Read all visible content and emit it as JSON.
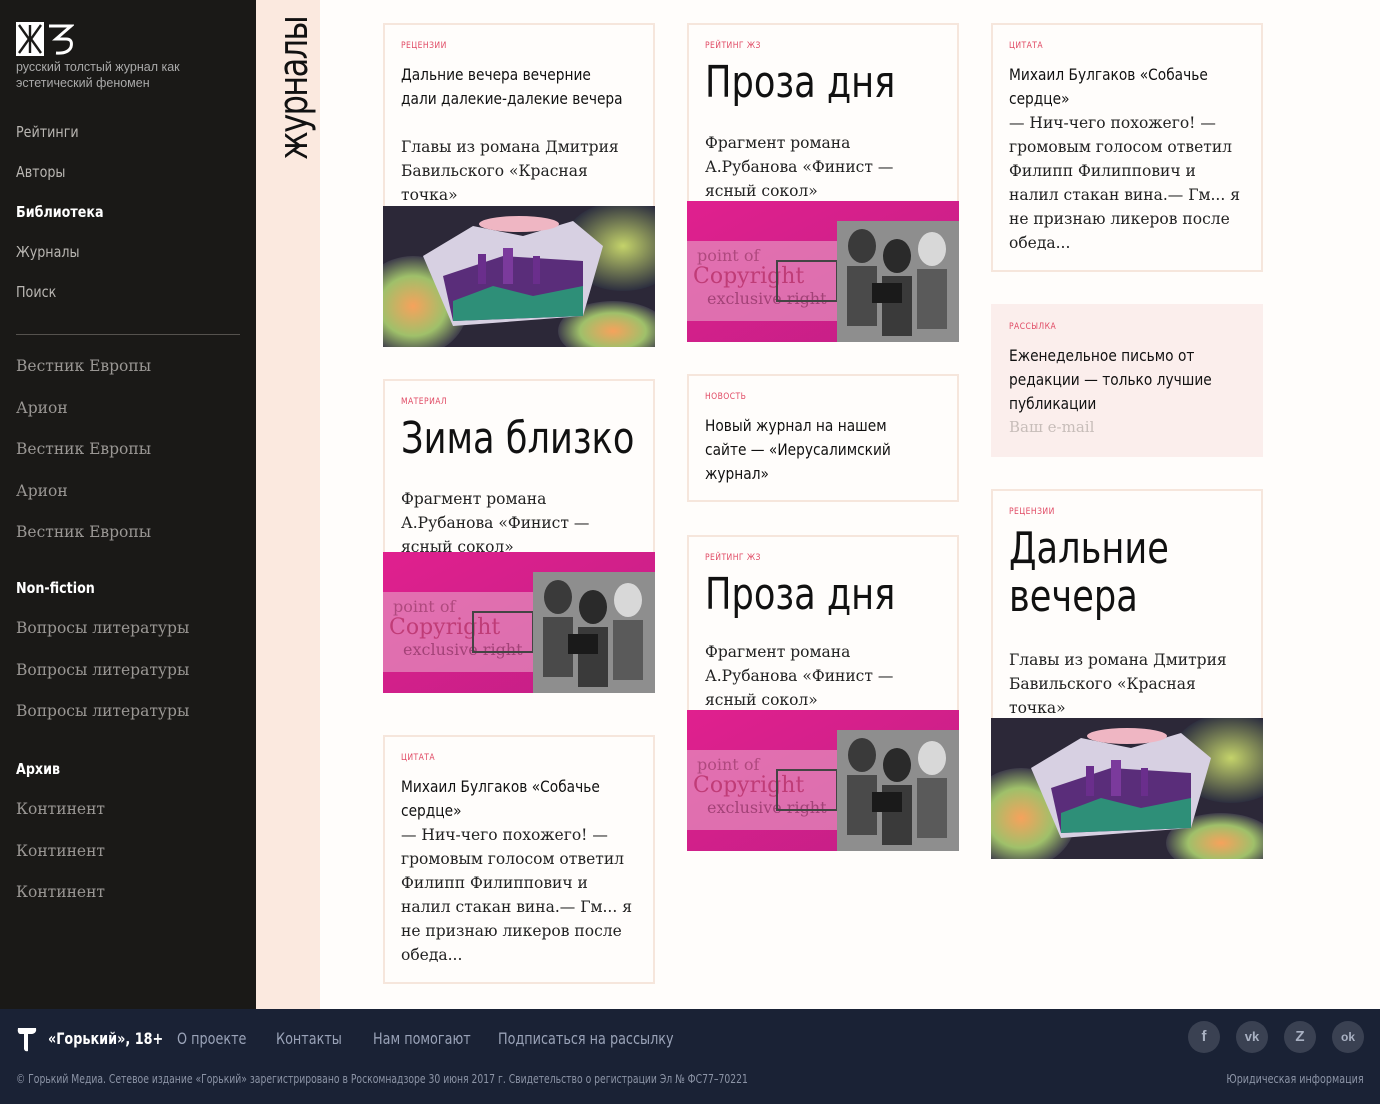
{
  "brand": {
    "logo_text": "ЖЗ",
    "tagline": "русский толстый журнал как эстетический феномен"
  },
  "nav": {
    "items": [
      {
        "label": "Рейтинги",
        "active": false
      },
      {
        "label": "Авторы",
        "active": false
      },
      {
        "label": "Библиотека",
        "active": true
      },
      {
        "label": "Журналы",
        "active": false
      },
      {
        "label": "Поиск",
        "active": false
      }
    ]
  },
  "journals": {
    "group1": [
      "Вестник Европы",
      "Арион",
      "Вестник Европы",
      "Арион",
      "Вестник Европы"
    ],
    "nonfiction_heading": "Non-fiction",
    "group2": [
      "Вопросы литературы",
      "Вопросы литературы",
      "Вопросы литературы"
    ],
    "archive_heading": "Архив",
    "group3": [
      "Континент",
      "Континент",
      "Континент"
    ]
  },
  "section_title": "журналы",
  "cards": {
    "c1": {
      "tag": "рецензии",
      "headline": "Дальние вечера вечерние дали далекие-далекие вечера",
      "desc": "Главы из романа Дмитрия Бавильского «Красная точка»"
    },
    "c2": {
      "tag": "материал",
      "title": "Зима близко",
      "desc": "Фрагмент романа А.Рубанова «Финист — ясный сокол»"
    },
    "c3": {
      "tag": "цитата",
      "headline": "Михаил Булгаков «Собачье сердце»",
      "desc": "— Нич-чего похожего! — громовым голосом ответил Филипп Филиппович и налил стакан вина.— Гм... я не признаю ликеров после обеда..."
    },
    "c4": {
      "tag": "рейтинг жз",
      "title": "Проза дня",
      "desc": "Фрагмент романа А.Рубанова «Финист — ясный сокол»"
    },
    "c5": {
      "tag": "новость",
      "headline": "Новый журнал на нашем сайте — «Иерусалимский журнал»"
    },
    "c6": {
      "tag": "рейтинг жз",
      "title": "Проза дня",
      "desc": "Фрагмент романа А.Рубанова «Финист — ясный сокол»"
    },
    "c7": {
      "tag": "цитата",
      "headline": "Михаил Булгаков «Собачье сердце»",
      "desc": "— Нич-чего похожего! — громовым голосом ответил Филипп Филиппович и налил стакан вина.— Гм... я не признаю ликеров после обеда..."
    },
    "c8": {
      "tag": "рассылка",
      "headline": "Еженедельное письмо от редакции — только лучшие публикации",
      "email_placeholder": "Ваш e-mail"
    },
    "c9": {
      "tag": "рецензии",
      "title": "Дальние вечера",
      "desc": "Главы из романа Дмитрия Бавильского «Красная точка»"
    }
  },
  "footer": {
    "brand": "«Горький», 18+",
    "links": [
      "О проекте",
      "Контакты",
      "Нам помогают",
      "Подписаться на рассылку"
    ],
    "social": [
      {
        "icon": "facebook-icon",
        "glyph": "f"
      },
      {
        "icon": "vk-icon",
        "glyph": "vk"
      },
      {
        "icon": "livejournal-icon",
        "glyph": "Z"
      },
      {
        "icon": "odnoklassniki-icon",
        "glyph": "ok"
      }
    ],
    "copyright": "© Горький Медиа. Сетевое издание «Горький» зарегистрировано в Роскомнадзоре 30 июня 2017 г. Свидетельство о регистрации Эл № ФС77–70221",
    "legal": "Юридическая информация"
  },
  "colors": {
    "sidebar_bg": "#1a1917",
    "band_bg": "#fbe9df",
    "tag_red": "#e04a64",
    "footer_bg": "#1a2235",
    "card_border": "#f6e6dc",
    "newsletter_bg": "#fbeeec"
  }
}
